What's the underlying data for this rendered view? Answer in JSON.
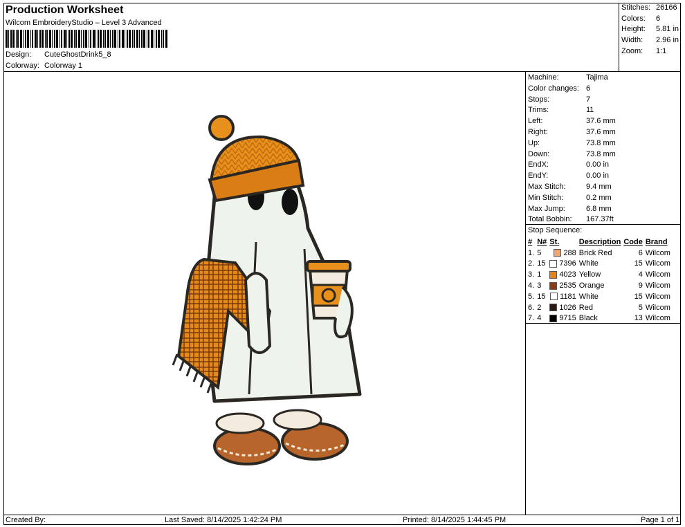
{
  "header": {
    "title": "Production Worksheet",
    "subtitle": "Wilcom EmbroideryStudio – Level 3 Advanced",
    "design_label": "Design:",
    "design_value": "CuteGhostDrink5_8",
    "colorway_label": "Colorway:",
    "colorway_value": "Colorway 1"
  },
  "stats": [
    {
      "label": "Stitches:",
      "value": "26166"
    },
    {
      "label": "Colors:",
      "value": "6"
    },
    {
      "label": "Height:",
      "value": "5.81 in"
    },
    {
      "label": "Width:",
      "value": "2.96 in"
    },
    {
      "label": "Zoom:",
      "value": "1:1"
    }
  ],
  "machine": [
    {
      "label": "Machine:",
      "value": "Tajima"
    },
    {
      "label": "Color changes:",
      "value": "6"
    },
    {
      "label": "Stops:",
      "value": "7"
    },
    {
      "label": "Trims:",
      "value": "11"
    },
    {
      "label": "Left:",
      "value": "37.6 mm"
    },
    {
      "label": "Right:",
      "value": "37.6 mm"
    },
    {
      "label": "Up:",
      "value": "73.8 mm"
    },
    {
      "label": "Down:",
      "value": "73.8 mm"
    },
    {
      "label": "EndX:",
      "value": "0.00 in"
    },
    {
      "label": "EndY:",
      "value": "0.00 in"
    },
    {
      "label": "Max Stitch:",
      "value": "9.4 mm"
    },
    {
      "label": "Min Stitch:",
      "value": "0.2 mm"
    },
    {
      "label": "Max Jump:",
      "value": "6.8 mm"
    },
    {
      "label": "Total Bobbin:",
      "value": "167.37ft"
    }
  ],
  "stop_sequence": {
    "title": "Stop Sequence:",
    "headers": [
      "#",
      "N#",
      "St.",
      "Description",
      "Code",
      "Brand"
    ],
    "rows": [
      {
        "num": "1.",
        "n": "5",
        "color": "#f3a36b",
        "st": "288",
        "desc": "Brick Red",
        "code": "6",
        "brand": "Wilcom"
      },
      {
        "num": "2.",
        "n": "15",
        "color": "#ffffff",
        "st": "7396",
        "desc": "White",
        "code": "15",
        "brand": "Wilcom"
      },
      {
        "num": "3.",
        "n": "1",
        "color": "#e8830e",
        "st": "4023",
        "desc": "Yellow",
        "code": "4",
        "brand": "Wilcom"
      },
      {
        "num": "4.",
        "n": "3",
        "color": "#8a3c12",
        "st": "2535",
        "desc": "Orange",
        "code": "9",
        "brand": "Wilcom"
      },
      {
        "num": "5.",
        "n": "15",
        "color": "#ffffff",
        "st": "1181",
        "desc": "White",
        "code": "15",
        "brand": "Wilcom"
      },
      {
        "num": "6.",
        "n": "2",
        "color": "#2a1a14",
        "st": "1026",
        "desc": "Red",
        "code": "5",
        "brand": "Wilcom"
      },
      {
        "num": "7.",
        "n": "4",
        "color": "#000000",
        "st": "9715",
        "desc": "Black",
        "code": "13",
        "brand": "Wilcom"
      }
    ]
  },
  "footer": {
    "created_by": "Created By:",
    "last_saved": "Last Saved: 8/14/2025 1:42:24 PM",
    "printed": "Printed: 8/14/2025 1:44:45 PM",
    "page": "Page 1 of 1"
  }
}
